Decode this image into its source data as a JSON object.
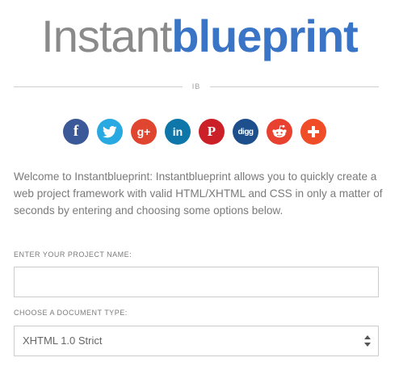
{
  "logo": {
    "light_text": "Instant",
    "bold_text": "blueprint"
  },
  "divider": {
    "mark": "IB"
  },
  "social": [
    {
      "network": "facebook",
      "glyph": "f",
      "color": "#3b5998"
    },
    {
      "network": "twitter",
      "glyph": "",
      "color": "#29a9e1"
    },
    {
      "network": "google-plus",
      "glyph": "g+",
      "color": "#e0452f"
    },
    {
      "network": "linkedin",
      "glyph": "in",
      "color": "#0e76a8"
    },
    {
      "network": "pinterest",
      "glyph": "P",
      "color": "#cb2027"
    },
    {
      "network": "digg",
      "glyph": "digg",
      "color": "#1d4f8c"
    },
    {
      "network": "reddit",
      "glyph": "",
      "color": "#e8412f"
    },
    {
      "network": "addthis",
      "glyph": "+",
      "color": "#f04c27"
    }
  ],
  "intro": {
    "text": "Welcome to Instantblueprint: Instantblueprint allows you to quickly create a web project framework with valid HTML/XHTML and CSS in only a matter of seconds by entering and choosing some options below."
  },
  "form": {
    "project_name": {
      "label": "ENTER YOUR PROJECT NAME:",
      "value": "",
      "placeholder": ""
    },
    "doc_type": {
      "label": "CHOOSE A DOCUMENT TYPE:",
      "selected": "XHTML 1.0 Strict"
    }
  }
}
